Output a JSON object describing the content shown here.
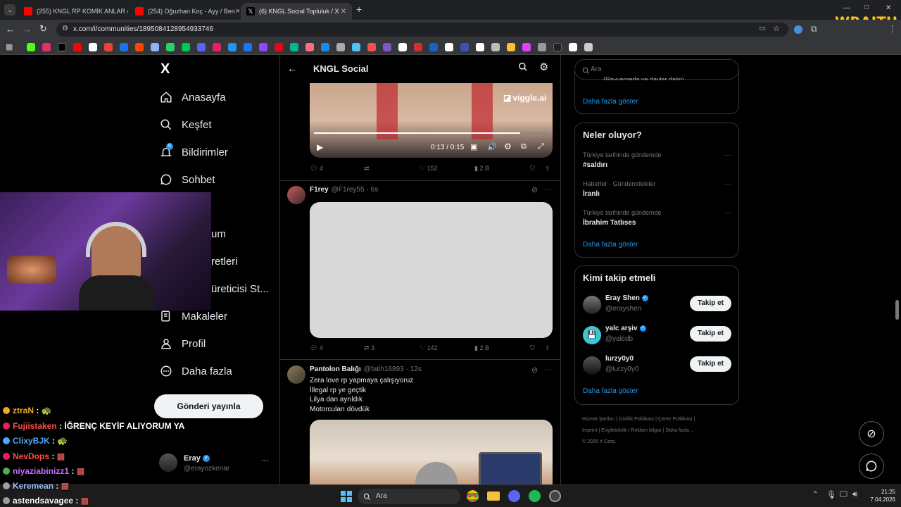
{
  "browser": {
    "tabs": [
      {
        "title": "(255) KNGL RP KOMİK ANLAR #",
        "active": false,
        "favicon_color": "#ff0000"
      },
      {
        "title": "(254) Oğuzhan Koç - Ayy / Ben",
        "active": false,
        "favicon_color": "#ff0000"
      },
      {
        "title": "(6) KNGL Social Topluluk / X",
        "active": true,
        "favicon_color": "#ffffff"
      }
    ],
    "new_tab": "+",
    "url": "x.com/i/communities/1895084128954933746",
    "window_controls": [
      "—",
      "□",
      "✕"
    ]
  },
  "overlay": {
    "brand": "WRAITH"
  },
  "sidebar": {
    "logo": "X",
    "items": [
      {
        "label": "Anasayfa",
        "icon": "home-icon"
      },
      {
        "label": "Keşfet",
        "icon": "search-icon"
      },
      {
        "label": "Bildirimler",
        "icon": "bell-icon",
        "badge": "6"
      },
      {
        "label": "Sohbet",
        "icon": "chat-icon"
      },
      {
        "label": "um",
        "icon": "hidden"
      },
      {
        "label": "retleri",
        "icon": "hidden"
      },
      {
        "label": "üreticisi St...",
        "icon": "hidden"
      },
      {
        "label": "Makaleler",
        "icon": "article-icon"
      },
      {
        "label": "Profil",
        "icon": "person-icon"
      },
      {
        "label": "Daha fazla",
        "icon": "more-circle-icon"
      }
    ],
    "post_button": "Gönderi yayınla",
    "account": {
      "name": "Eray",
      "handle": "@erayozkenar",
      "more": "···"
    }
  },
  "feed": {
    "header_title": "KNGL Social",
    "posts": [
      {
        "video_watermark": "viggle.ai",
        "time": "0:13 / 0:15",
        "replies": "4",
        "retweets": "",
        "likes": "152",
        "views": "2 B"
      },
      {
        "author": "F1rey",
        "handle": "@F1rey55",
        "age": "· 6s",
        "replies": "4",
        "retweets": "3",
        "likes": "142",
        "views": "2 B"
      },
      {
        "author": "Pantolon Balığı",
        "handle": "@fatih16893",
        "age": "· 12s",
        "lines": [
          "Zera love rp yapmaya çalışıyoruz",
          "İllegal rp ye geçtik",
          "Lilya dan ayrıldık",
          "Motorcuları dövdük"
        ]
      }
    ]
  },
  "right": {
    "search_placeholder": "Ara",
    "top_partial": "(Rayvarneda ve dayler dalin)",
    "show_more_1": "Daha fazla göster",
    "trends_title": "Neler oluyor?",
    "trends": [
      {
        "category": "Türkiye tarihinde gündemde",
        "title": "#saldırı"
      },
      {
        "category": "Haberler · Gündemdekiler",
        "title": "İranlı"
      },
      {
        "category": "Türkiye tarihinde gündemde",
        "title": "İbrahim Tatlıses"
      }
    ],
    "show_more_2": "Daha fazla göster",
    "follow_title": "Kimi takip etmeli",
    "follow": [
      {
        "name": "Eray Shen",
        "handle": "@erayshen",
        "verified": true,
        "button": "Takip et"
      },
      {
        "name": "yalc arşiv",
        "handle": "@yalcdb",
        "verified": true,
        "button": "Takip et"
      },
      {
        "name": "lurzy0y0",
        "handle": "@lurzy0y0",
        "verified": false,
        "button": "Takip et"
      }
    ],
    "show_more_3": "Daha fazla göster",
    "footer_line1": [
      "Hizmet Şartları",
      "Gizlilik Politikası",
      "Çerez Politikası"
    ],
    "footer_line2": [
      "Imprint",
      "Erişilebilirlik",
      "Reklam bilgisi",
      "Daha fazla ..."
    ],
    "copyright": "© 2026 X Corp."
  },
  "chat": [
    {
      "user": "ztraN",
      "msg": "🐢",
      "color": "#f5a623"
    },
    {
      "user": "Fujiistaken",
      "msg": "İĞRENÇ KEYİF ALIYORUM YA",
      "color": "#ff4d4d"
    },
    {
      "user": "ClixyBJK",
      "msg": "🐢",
      "color": "#4da6ff"
    },
    {
      "user": "NevDops",
      "msg": "▩",
      "color": "#ff4d4d"
    },
    {
      "user": "niyaziabinizz1",
      "msg": "▩",
      "color": "#c86bff"
    },
    {
      "user": "Keremean",
      "msg": "▩",
      "color": "#a0c4ff"
    },
    {
      "user": "astendsavagee",
      "msg": "▩",
      "color": "#ffffff"
    }
  ],
  "taskbar": {
    "search": "Ara",
    "time": "21:25",
    "date": "7.04.2026"
  }
}
